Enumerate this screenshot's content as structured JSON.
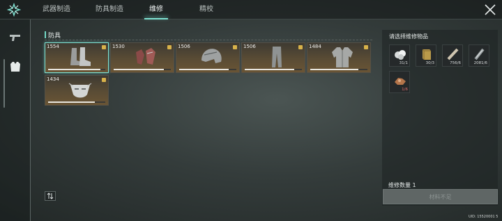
{
  "tabs": [
    {
      "label": "武器制造",
      "active": false
    },
    {
      "label": "防具制造",
      "active": false
    },
    {
      "label": "维修",
      "active": true
    },
    {
      "label": "精校",
      "active": false
    }
  ],
  "sidebar": {
    "items": [
      {
        "icon": "pistol-icon"
      },
      {
        "icon": "vest-icon"
      }
    ]
  },
  "section": {
    "title": "防具"
  },
  "items": [
    {
      "value": "1554",
      "icon": "boots-icon",
      "durability": 0.92
    },
    {
      "value": "1530",
      "icon": "gloves-icon",
      "durability": 0.88
    },
    {
      "value": "1506",
      "icon": "helmet-icon",
      "durability": 0.86
    },
    {
      "value": "1506",
      "icon": "pants-icon",
      "durability": 0.86
    },
    {
      "value": "1484",
      "icon": "jacket-icon",
      "durability": 0.84
    },
    {
      "value": "1434",
      "icon": "mask-icon",
      "durability": 0.82
    }
  ],
  "panel": {
    "title": "请选择维修物品",
    "materials": [
      {
        "icon": "crystal-icon",
        "count": "31/1",
        "short": false
      },
      {
        "icon": "gold-block-icon",
        "count": "30/3",
        "short": false
      },
      {
        "icon": "rod-icon",
        "count": "756/6",
        "short": false
      },
      {
        "icon": "steel-bar-icon",
        "count": "2081/6",
        "short": false
      },
      {
        "icon": "ore-icon",
        "count": "1/6",
        "short": true
      }
    ],
    "quantity_label": "维修数量 1",
    "action_label": "材料不足"
  },
  "uid": "UID: 15520001 5",
  "colors": {
    "accent": "#7fe3d3",
    "insufficient": "#e26d6d",
    "badge": "#d8b24a"
  }
}
